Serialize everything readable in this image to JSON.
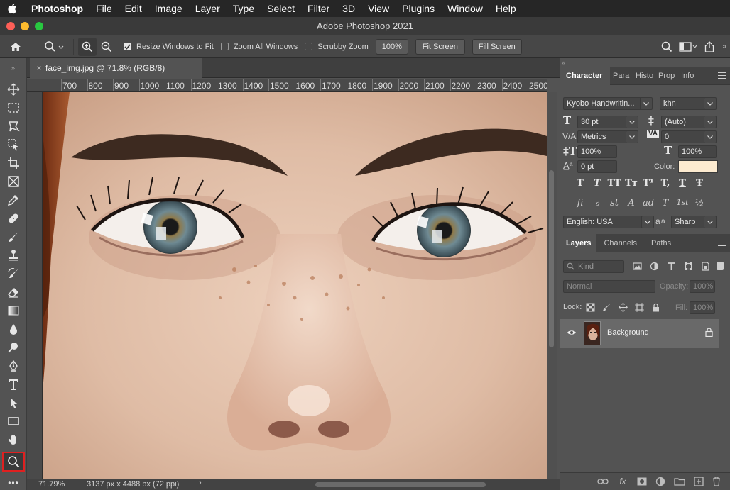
{
  "menubar": {
    "app": "Photoshop",
    "items": [
      "File",
      "Edit",
      "Image",
      "Layer",
      "Type",
      "Select",
      "Filter",
      "3D",
      "View",
      "Plugins",
      "Window",
      "Help"
    ]
  },
  "window": {
    "title": "Adobe Photoshop 2021",
    "traffic_colors": [
      "#fe5f57",
      "#febc2e",
      "#28c840"
    ]
  },
  "options": {
    "resize_windows": {
      "label": "Resize Windows to Fit",
      "checked": true
    },
    "zoom_all": {
      "label": "Zoom All Windows",
      "checked": false
    },
    "scrubby": {
      "label": "Scrubby Zoom",
      "checked": false
    },
    "zoom_100": "100%",
    "fit_screen": "Fit Screen",
    "fill_screen": "Fill Screen"
  },
  "document": {
    "tab_title": "face_img.jpg @ 71.8% (RGB/8)",
    "close_glyph": "×",
    "ruler_labels": [
      "700",
      "800",
      "900",
      "1000",
      "1100",
      "1200",
      "1300",
      "1400",
      "1500",
      "1600",
      "1700",
      "1800",
      "1900",
      "2000",
      "2100",
      "2200",
      "2300",
      "2400",
      "2500"
    ]
  },
  "status": {
    "zoom": "71.79%",
    "info": "3137 px x 4488 px (72 ppi)"
  },
  "tools": {
    "active": "zoom-tool",
    "highlight_color": "#e02020",
    "more": "•••"
  },
  "character_panel": {
    "tabs": [
      "Character",
      "Para",
      "Histo",
      "Prop",
      "Info"
    ],
    "font_family": "Kyobo Handwritin...",
    "font_style": "khn",
    "font_size": "30 pt",
    "leading": "(Auto)",
    "kerning": "Metrics",
    "tracking": "0",
    "vscale": "100%",
    "hscale": "100%",
    "baseline": "0 pt",
    "color_label": "Color:",
    "color_swatch": "#fdebd0",
    "language": "English: USA",
    "aa_label": "a",
    "antialias": "Sharp",
    "style_glyphs": [
      "T",
      "T",
      "TT",
      "Tт",
      "T¹",
      "T,",
      "T",
      "Ŧ"
    ],
    "ot_glyphs": [
      "ﬁ",
      "ℴ",
      "st",
      "A",
      "ād",
      "T",
      "1st",
      "½"
    ]
  },
  "layers_panel": {
    "tabs": [
      "Layers",
      "Channels",
      "Paths"
    ],
    "filter_kind": "Kind",
    "blend_mode": "Normal",
    "opacity_label": "Opacity:",
    "opacity": "100%",
    "lock_label": "Lock:",
    "fill_label": "Fill:",
    "fill": "100%",
    "layer_name": "Background",
    "fx": "fx"
  }
}
